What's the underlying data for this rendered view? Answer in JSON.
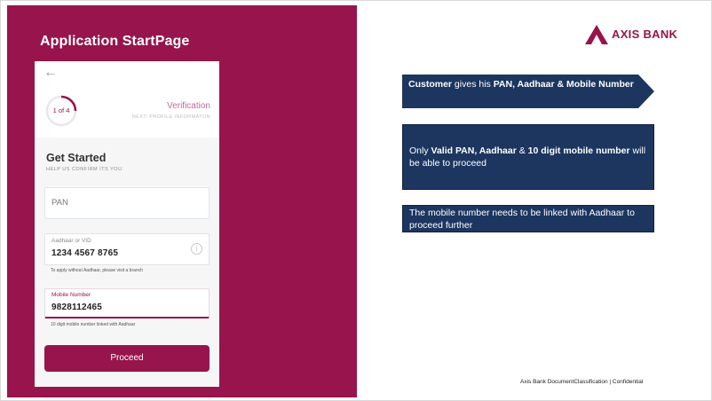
{
  "slide": {
    "title": "Application StartPage",
    "footer": "Axis Bank DocumentClassification | Confidential",
    "brand_color": "#97144d",
    "note_color": "#1c3660"
  },
  "logo": {
    "text": "AXIS BANK"
  },
  "phone": {
    "back_icon": "back-arrow-icon",
    "progress": {
      "label": "1 of 4",
      "current_step": 1,
      "total_steps": 4
    },
    "step_title": "Verification",
    "step_next": "NEXT: PROFILE INFORMATON",
    "heading": "Get Started",
    "subheading": "HELP US CONFIRM ITS YOU",
    "pan": {
      "placeholder": "PAN"
    },
    "aadhaar": {
      "label": "Aadhaar or VID",
      "value": "1234 4567 8765",
      "hint": "To apply without Aadhaar, please visit a branch"
    },
    "mobile": {
      "label": "Mobile Number",
      "value": "9828112465",
      "hint": "10 digit mobile number linked with Aadhaar"
    },
    "proceed_label": "Proceed"
  },
  "notes": {
    "n1": {
      "a": "Customer",
      "b": " gives his ",
      "c": "PAN, Aadhaar & Mobile Number"
    },
    "n2": {
      "a": " Only ",
      "b": "Valid PAN, Aadhaar",
      "c": " & ",
      "d": "10 digit mobile number",
      "e": " will be able to proceed"
    },
    "n3": {
      "text": " The mobile number needs to be linked with Aadhaar to proceed further"
    }
  }
}
